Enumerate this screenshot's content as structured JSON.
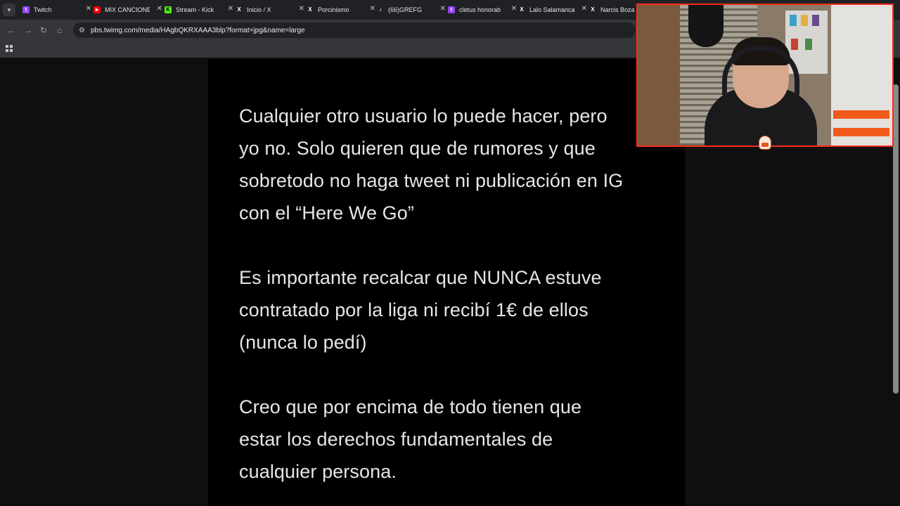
{
  "browser": {
    "tabs": [
      {
        "title": "Twitch",
        "favicon": "twitch-icon",
        "color": "#9146ff"
      },
      {
        "title": "MIX CANCIONES",
        "favicon": "youtube-icon",
        "color": "#ff0000"
      },
      {
        "title": "Stream - Kick",
        "favicon": "kick-icon",
        "color": "#53fc18"
      },
      {
        "title": "Inicio / X",
        "favicon": "x-icon",
        "color": "#ffffff"
      },
      {
        "title": "Porcinismo",
        "favicon": "x-icon",
        "color": "#ffffff"
      },
      {
        "title": "(66)GREFG",
        "favicon": "tiktok-icon",
        "color": "#ffffff"
      },
      {
        "title": "cletus honorab",
        "favicon": "twitch-icon",
        "color": "#9146ff"
      },
      {
        "title": "Lalo Salamanca",
        "favicon": "x-icon",
        "color": "#ffffff"
      },
      {
        "title": "Narcis Boza",
        "favicon": "x-icon",
        "color": "#ffffff"
      }
    ],
    "address_url": "pbs.twimg.com/media/HAgbQKRXAAA3blp?format=jpg&name=large"
  },
  "document": {
    "paragraphs": [
      {
        "lines": [
          "Cualquier otro usuario lo puede hacer, pero",
          "yo no. Solo quieren que de rumores y que",
          "sobretodo no haga tweet ni publicación en IG",
          "con el “Here We Go”"
        ]
      },
      {
        "lines": [
          "Es importante recalcar que NUNCA estuve",
          "contratado por la liga ni recibí 1€ de ellos",
          "(nunca lo pedí)"
        ]
      },
      {
        "lines": [
          "Creo que por encima de todo tienen que",
          "estar los derechos fundamentales de",
          "cualquier persona."
        ]
      }
    ]
  },
  "webcam": {
    "border_color": "#ff2a1a"
  }
}
